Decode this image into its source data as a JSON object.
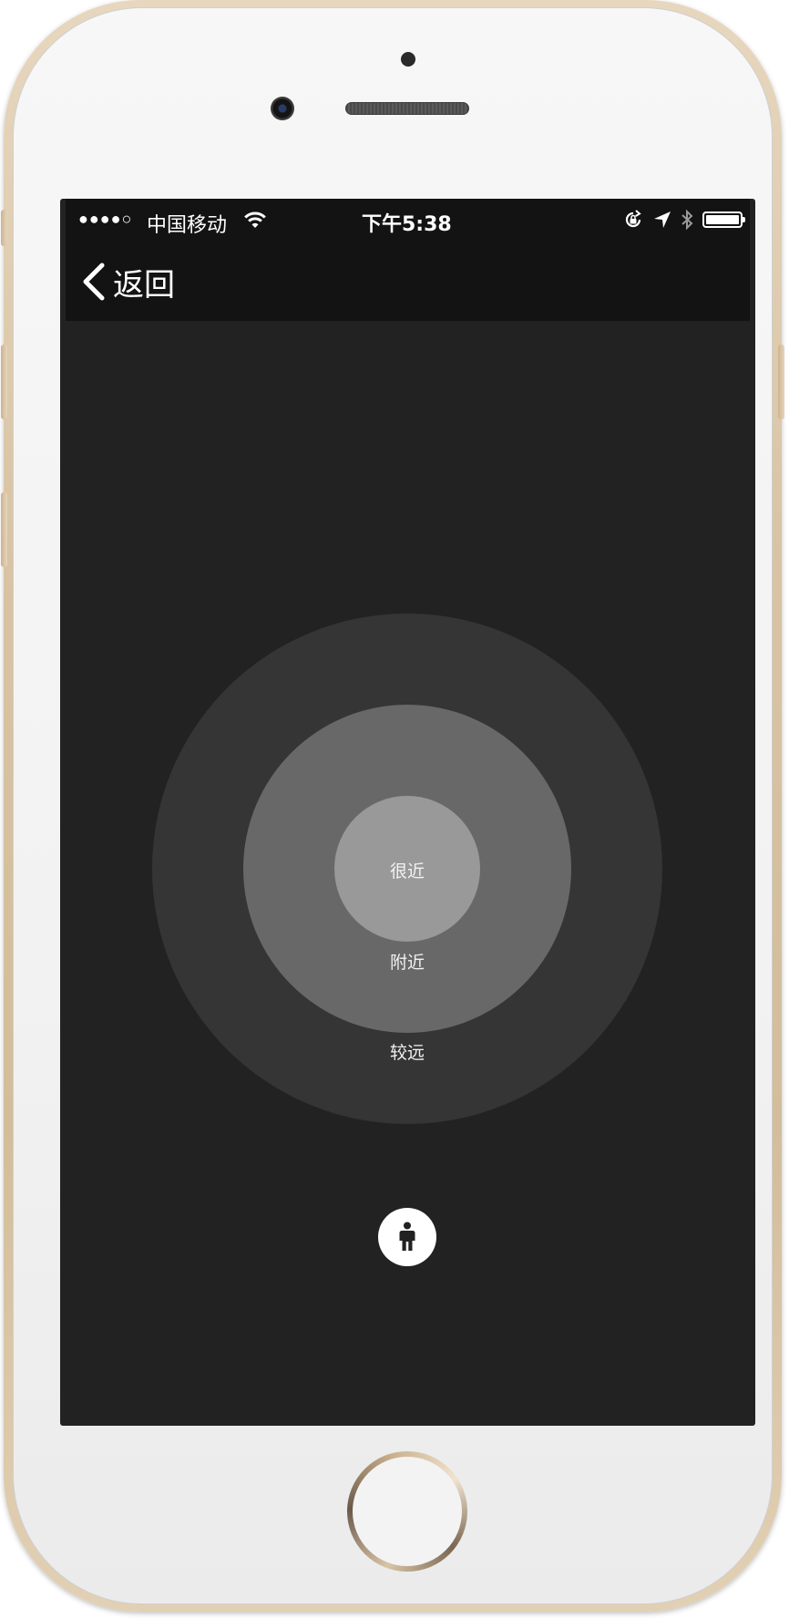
{
  "status_bar": {
    "signal": "●●●●○",
    "carrier": "中国移动",
    "time": "下午5:38",
    "icons": [
      "wifi-icon",
      "rotation-lock-icon",
      "location-arrow-icon",
      "bluetooth-icon",
      "battery-icon"
    ],
    "battery_level": 1.0
  },
  "nav": {
    "back_label": "返回"
  },
  "radar": {
    "very_near_label": "很近",
    "near_label": "附近",
    "far_label": "较远",
    "colors": {
      "far": "#353535",
      "near": "#686868",
      "very_near": "#999999"
    }
  },
  "user_button": {
    "icon": "person-icon"
  },
  "colors": {
    "screen_background": "#222222",
    "nav_background": "#131313",
    "device_frame": "#d8c3a3"
  }
}
